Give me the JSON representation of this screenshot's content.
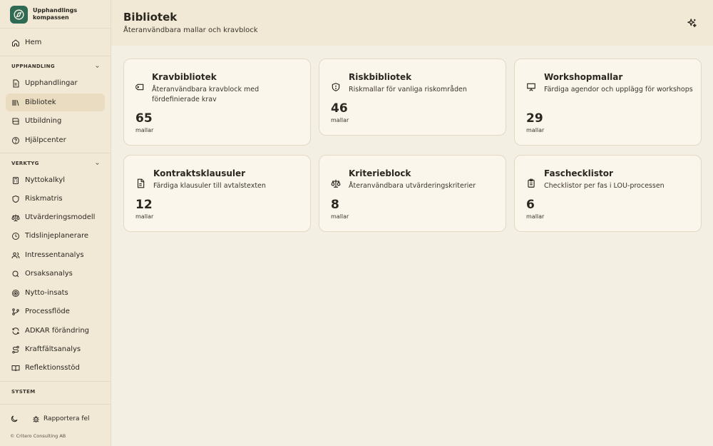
{
  "brand": {
    "name_line1": "Upphandlings",
    "name_line2": "kompassen"
  },
  "nav": {
    "home": "Hem",
    "section_upphandling": "UPPHANDLING",
    "upphandling_items": [
      "Upphandlingar",
      "Bibliotek",
      "Utbildning",
      "Hjälpcenter"
    ],
    "section_verktyg": "VERKTYG",
    "verktyg_items": [
      "Nyttokalkyl",
      "Riskmatris",
      "Utvärderingsmodell",
      "Tidslinjeplanerare",
      "Intressentanalys",
      "Orsaksanalys",
      "Nytto-insats",
      "Processflöde",
      "ADKAR förändring",
      "Kraftfältsanalys",
      "Reflektionsstöd"
    ],
    "section_system": "SYSTEM",
    "active": "Bibliotek"
  },
  "footer": {
    "report": "Rapportera fel",
    "copyright": "© Critero Consulting AB"
  },
  "header": {
    "title": "Bibliotek",
    "subtitle": "Återanvändbara mallar och kravblock"
  },
  "cards": [
    {
      "icon": "tag-icon",
      "title": "Kravbibliotek",
      "desc": "Återanvändbara kravblock med fördefinierade krav",
      "count": "65",
      "unit": "mallar"
    },
    {
      "icon": "shield-icon",
      "title": "Riskbibliotek",
      "desc": "Riskmallar för vanliga riskområden",
      "count": "46",
      "unit": "mallar"
    },
    {
      "icon": "presentation-icon",
      "title": "Workshopmallar",
      "desc": "Färdiga agendor och upplägg för workshops",
      "count": "29",
      "unit": "mallar"
    },
    {
      "icon": "document-icon",
      "title": "Kontraktsklausuler",
      "desc": "Färdiga klausuler till avtalstexten",
      "count": "12",
      "unit": "mallar"
    },
    {
      "icon": "scale-icon",
      "title": "Kriterieblock",
      "desc": "Återanvändbara utvärderingskriterier",
      "count": "8",
      "unit": "mallar"
    },
    {
      "icon": "clipboard-icon",
      "title": "Faschecklistor",
      "desc": "Checklistor per fas i LOU-processen",
      "count": "6",
      "unit": "mallar"
    }
  ],
  "colors": {
    "accent": "#2f6a55",
    "sidebar_bg": "#f1e9d6",
    "active_bg": "#e9dcc1",
    "card_bg": "#fbf6eb"
  }
}
